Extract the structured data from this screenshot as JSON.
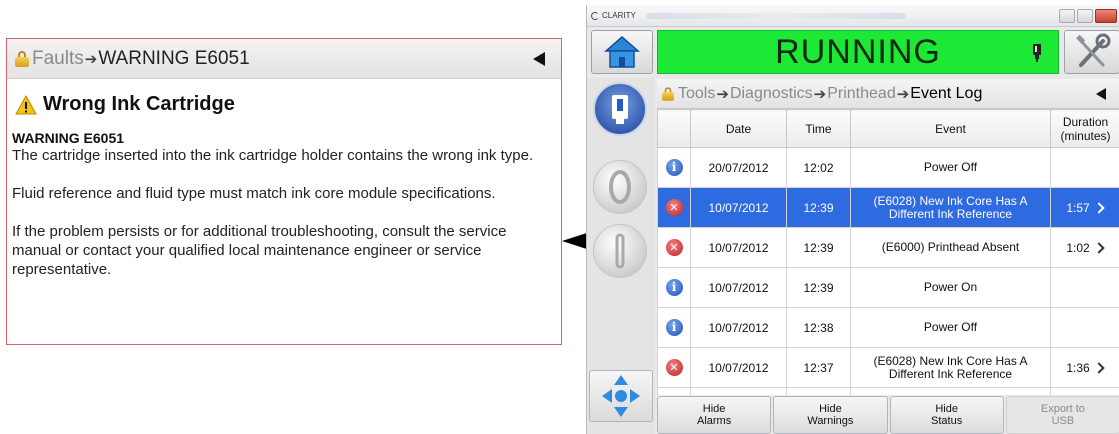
{
  "warning_panel": {
    "breadcrumb": {
      "parent": "Faults",
      "separator": "➔",
      "current": "WARNING E6051"
    },
    "title": "Wrong Ink Cartridge",
    "code": "WARNING E6051",
    "paragraphs": [
      "The cartridge inserted into the ink cartridge holder contains the wrong ink type.",
      "Fluid reference and fluid type must match ink core module specifications.",
      "If the problem persists or for additional troubleshooting, consult the service manual or contact your qualified local maintenance engineer or service representative."
    ]
  },
  "device": {
    "window_title": "CLARITY",
    "status": "RUNNING",
    "status_color": "#1ee836",
    "breadcrumb": [
      "Tools",
      "Diagnostics",
      "Printhead",
      "Event Log"
    ],
    "breadcrumb_separator": "➔",
    "table": {
      "headers": {
        "date": "Date",
        "time": "Time",
        "event": "Event",
        "duration": "Duration (minutes)"
      },
      "rows": [
        {
          "type": "info",
          "date": "20/07/2012",
          "time": "12:02",
          "event": "Power Off",
          "duration": ""
        },
        {
          "type": "error",
          "date": "10/07/2012",
          "time": "12:39",
          "event": "(E6028) New Ink Core Has A Different Ink Reference",
          "duration": "1:57",
          "selected": true
        },
        {
          "type": "error",
          "date": "10/07/2012",
          "time": "12:39",
          "event": "(E6000) Printhead Absent",
          "duration": "1:02"
        },
        {
          "type": "info",
          "date": "10/07/2012",
          "time": "12:39",
          "event": "Power On",
          "duration": ""
        },
        {
          "type": "info",
          "date": "10/07/2012",
          "time": "12:38",
          "event": "Power Off",
          "duration": ""
        },
        {
          "type": "error",
          "date": "10/07/2012",
          "time": "12:37",
          "event": "(E6028) New Ink Core Has A Different Ink Reference",
          "duration": "1:36"
        }
      ]
    },
    "buttons": {
      "hide_alarms": "Hide\nAlarms",
      "hide_warnings": "Hide\nWarnings",
      "hide_status": "Hide\nStatus",
      "export_usb": "Export to\nUSB"
    },
    "icons": {
      "home": "home-icon",
      "tools": "tools-icon",
      "ink": "ink-cartridge-icon",
      "nav_active": "printer-icon",
      "nav_start": "start-icon",
      "nav_stop": "stop-icon",
      "nav_pad": "direction-pad-icon",
      "info": "info-icon",
      "error": "error-icon"
    }
  }
}
